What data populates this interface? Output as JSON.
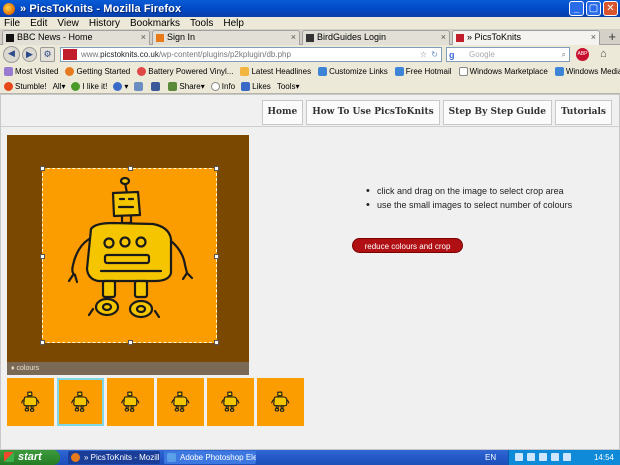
{
  "window": {
    "title": "» PicsToKnits - Mozilla Firefox"
  },
  "menu": [
    "File",
    "Edit",
    "View",
    "History",
    "Bookmarks",
    "Tools",
    "Help"
  ],
  "tabs": [
    {
      "label": "BBC News - Home",
      "active": false
    },
    {
      "label": "Sign In",
      "active": false
    },
    {
      "label": "BirdGuides Login",
      "active": false
    },
    {
      "label": "» PicsToKnits",
      "active": true
    }
  ],
  "nav": {
    "url_prefix": "www.",
    "url_domain": "picstoknits.co.uk",
    "url_path": "/wp-content/plugins/p2kplugin/db.php",
    "search_placeholder": "Google"
  },
  "bookmarks": [
    "Most Visited",
    "Getting Started",
    "Battery Powered Vinyl...",
    "Latest Headlines",
    "Customize Links",
    "Free Hotmail",
    "Windows Marketplace",
    "Windows Media"
  ],
  "stumble": {
    "stumble": "Stumble!",
    "all": "All",
    "like": "I like it!",
    "share": "Share",
    "info": "Info",
    "likes": "Likes",
    "tools": "Tools"
  },
  "site_nav": [
    "Home",
    "How To Use PicsToKnits",
    "Step By Step Guide",
    "Tutorials"
  ],
  "editor": {
    "colours_label": "colours",
    "instructions": [
      "click and drag on the image to select crop area",
      "use the small images to select number of colours"
    ],
    "crop_button": "reduce colours and crop",
    "thumbnail_count": 6,
    "selected_thumbnail": 2,
    "colors": {
      "background": "#7a4800",
      "artwork": "#fb9d00",
      "button": "#b01014",
      "selected": "#7fd7e6"
    }
  },
  "taskbar": {
    "start": "start",
    "tasks": [
      "» PicsToKnits - Mozilla ...",
      "Adobe Photoshop Ele..."
    ],
    "lang": "EN",
    "time": "14:54"
  }
}
